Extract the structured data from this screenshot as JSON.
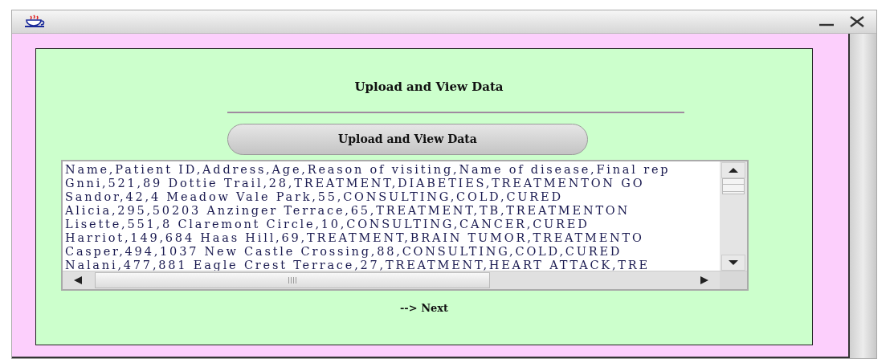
{
  "window": {
    "controls": [
      {
        "kind": "minimize"
      },
      {
        "kind": "close"
      }
    ]
  },
  "heading": "Upload and View Data",
  "upload_button": "Upload and View Data",
  "text_area": {
    "lines": [
      "Name,Patient ID,Address,Age,Reason of visiting,Name of disease,Final rep",
      "Gnni,521,89 Dottie Trail,28,TREATMENT,DIABETIES,TREATMENTON GO",
      "Sandor,42,4 Meadow Vale Park,55,CONSULTING,COLD,CURED",
      "Alicia,295,50203 Anzinger Terrace,65,TREATMENT,TB,TREATMENTON",
      "Lisette,551,8 Claremont Circle,10,CONSULTING,CANCER,CURED",
      "Harriot,149,684 Haas Hill,69,TREATMENT,BRAIN TUMOR,TREATMENTO",
      "Casper,494,1037 New Castle Crossing,88,CONSULTING,COLD,CURED",
      "Nalani,477,881 Eagle Crest Terrace,27,TREATMENT,HEART ATTACK,TRE"
    ]
  },
  "next_link": "--> Next"
}
